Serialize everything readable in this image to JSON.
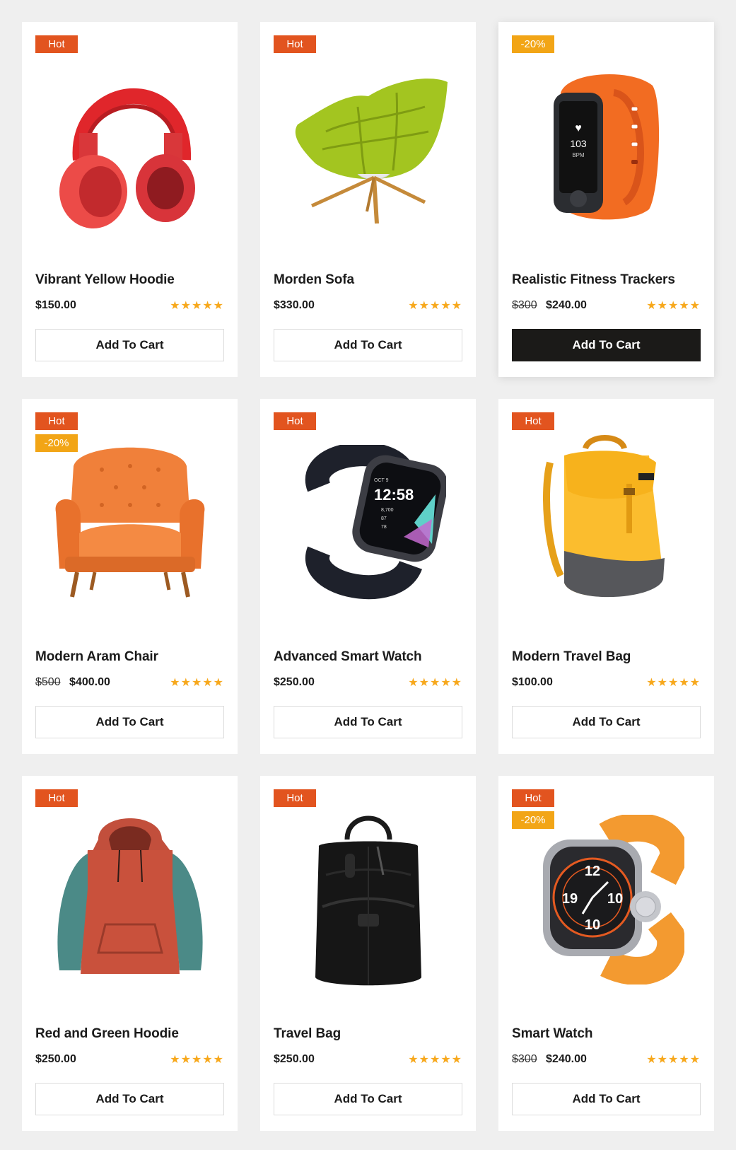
{
  "products": [
    {
      "title": "Vibrant Yellow Hoodie",
      "price": "$150.00",
      "old_price": "",
      "badges": [
        "Hot"
      ],
      "rating": "★★★★★",
      "button": "Add To Cart",
      "image_icon": "headphones-image"
    },
    {
      "title": "Morden Sofa",
      "price": "$330.00",
      "old_price": "",
      "badges": [
        "Hot"
      ],
      "rating": "★★★★★",
      "button": "Add To Cart",
      "image_icon": "lounge-chair-image"
    },
    {
      "title": "Realistic Fitness Trackers",
      "price": "$240.00",
      "old_price": "$300",
      "badges": [
        "-20%"
      ],
      "rating": "★★★★★",
      "button": "Add To Cart",
      "image_icon": "fitness-tracker-image",
      "tracker_screen": {
        "value": "103",
        "unit": "BPM"
      }
    },
    {
      "title": "Modern Aram Chair",
      "price": "$400.00",
      "old_price": "$500",
      "badges": [
        "Hot",
        "-20%"
      ],
      "rating": "★★★★★",
      "button": "Add To Cart",
      "image_icon": "armchair-image"
    },
    {
      "title": "Advanced Smart Watch",
      "price": "$250.00",
      "old_price": "",
      "badges": [
        "Hot"
      ],
      "rating": "★★★★★",
      "button": "Add To Cart",
      "image_icon": "smart-watch-image",
      "watch_screen": {
        "time": "12:58",
        "date": "OCT 9",
        "steps": "8,700",
        "line2": "87",
        "line3": "78"
      }
    },
    {
      "title": "Modern Travel Bag",
      "price": "$100.00",
      "old_price": "",
      "badges": [
        "Hot"
      ],
      "rating": "★★★★★",
      "button": "Add To Cart",
      "image_icon": "backpack-image"
    },
    {
      "title": "Red and Green Hoodie",
      "price": "$250.00",
      "old_price": "",
      "badges": [
        "Hot"
      ],
      "rating": "★★★★★",
      "button": "Add To Cart",
      "image_icon": "hoodie-image"
    },
    {
      "title": "Travel Bag",
      "price": "$250.00",
      "old_price": "",
      "badges": [
        "Hot"
      ],
      "rating": "★★★★★",
      "button": "Add To Cart",
      "image_icon": "black-bag-image"
    },
    {
      "title": "Smart Watch",
      "price": "$240.00",
      "old_price": "$300",
      "badges": [
        "Hot",
        "-20%"
      ],
      "rating": "★★★★★",
      "button": "Add To Cart",
      "image_icon": "orange-watch-image",
      "watch_face": {
        "top": "12",
        "left": "19",
        "right": "10",
        "bottom": "10"
      }
    }
  ],
  "active_card_index": 2,
  "colors": {
    "hot_badge": "#e2541f",
    "sale_badge": "#f2a516",
    "star": "#f7a81c",
    "primary_button": "#1b1a18"
  }
}
